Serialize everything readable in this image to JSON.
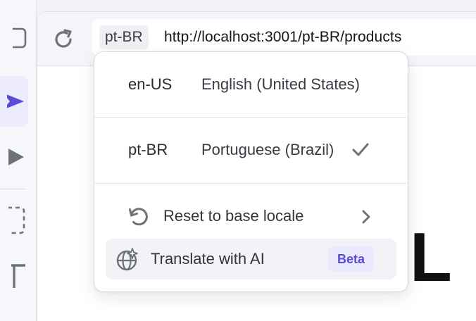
{
  "browser": {
    "locale_chip": "pt-BR",
    "url": "http://localhost:3001/pt-BR/products"
  },
  "page": {
    "partial_heading": "L"
  },
  "locale_menu": {
    "locales": [
      {
        "code": "en-US",
        "name": "English (United States)",
        "selected": false
      },
      {
        "code": "pt-BR",
        "name": "Portuguese (Brazil)",
        "selected": true
      }
    ],
    "actions": {
      "reset_label": "Reset to base locale",
      "translate_label": "Translate with AI",
      "translate_badge": "Beta"
    }
  },
  "colors": {
    "accent": "#5b4bd6",
    "accent_bg": "#ebe9fc",
    "icon_gray": "#6e707a"
  },
  "icons": {
    "reload": "reload-icon",
    "check": "check-icon",
    "reset": "reset-icon",
    "chevron": "chevron-right-icon",
    "translate": "globe-sparkle-icon"
  }
}
